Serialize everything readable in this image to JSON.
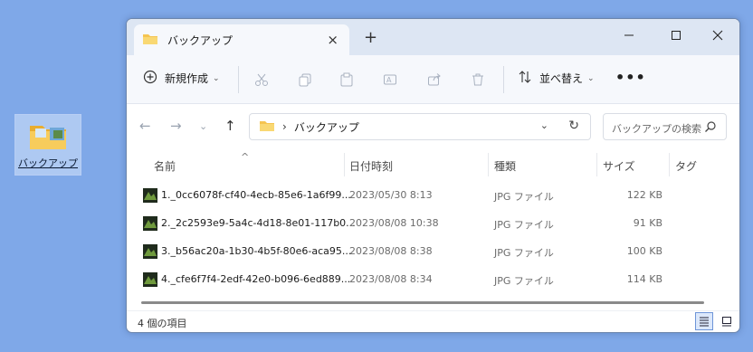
{
  "desktop": {
    "icon_label": "バックアップ"
  },
  "window": {
    "tab_title": "バックアップ",
    "tab_close": "×",
    "new_tab": "+",
    "toolbar": {
      "new_label": "新規作成",
      "sort_label": "並べ替え",
      "more": "•••"
    },
    "address": {
      "path": "バックアップ",
      "separator": "›"
    },
    "search": {
      "placeholder": "バックアップの検索"
    },
    "columns": {
      "name": "名前",
      "date": "日付時刻",
      "type": "種類",
      "size": "サイズ",
      "tag": "タグ"
    },
    "files": [
      {
        "name": "1._0cc6078f-cf40-4ecb-85e6-1a6f99...",
        "date": "2023/05/30 8:13",
        "type": "JPG ファイル",
        "size": "122 KB"
      },
      {
        "name": "2._2c2593e9-5a4c-4d18-8e01-117b0...",
        "date": "2023/08/08 10:38",
        "type": "JPG ファイル",
        "size": "91 KB"
      },
      {
        "name": "3._b56ac20a-1b30-4b5f-80e6-aca95...",
        "date": "2023/08/08 8:38",
        "type": "JPG ファイル",
        "size": "100 KB"
      },
      {
        "name": "4._cfe6f7f4-2edf-42e0-b096-6ed889...",
        "date": "2023/08/08 8:34",
        "type": "JPG ファイル",
        "size": "114 KB"
      }
    ],
    "status": {
      "item_count": "4 個の項目"
    },
    "colors": {
      "folder": "#f5c451",
      "accent": "#2a6fd6",
      "desktop": "#7fa8e8"
    }
  }
}
